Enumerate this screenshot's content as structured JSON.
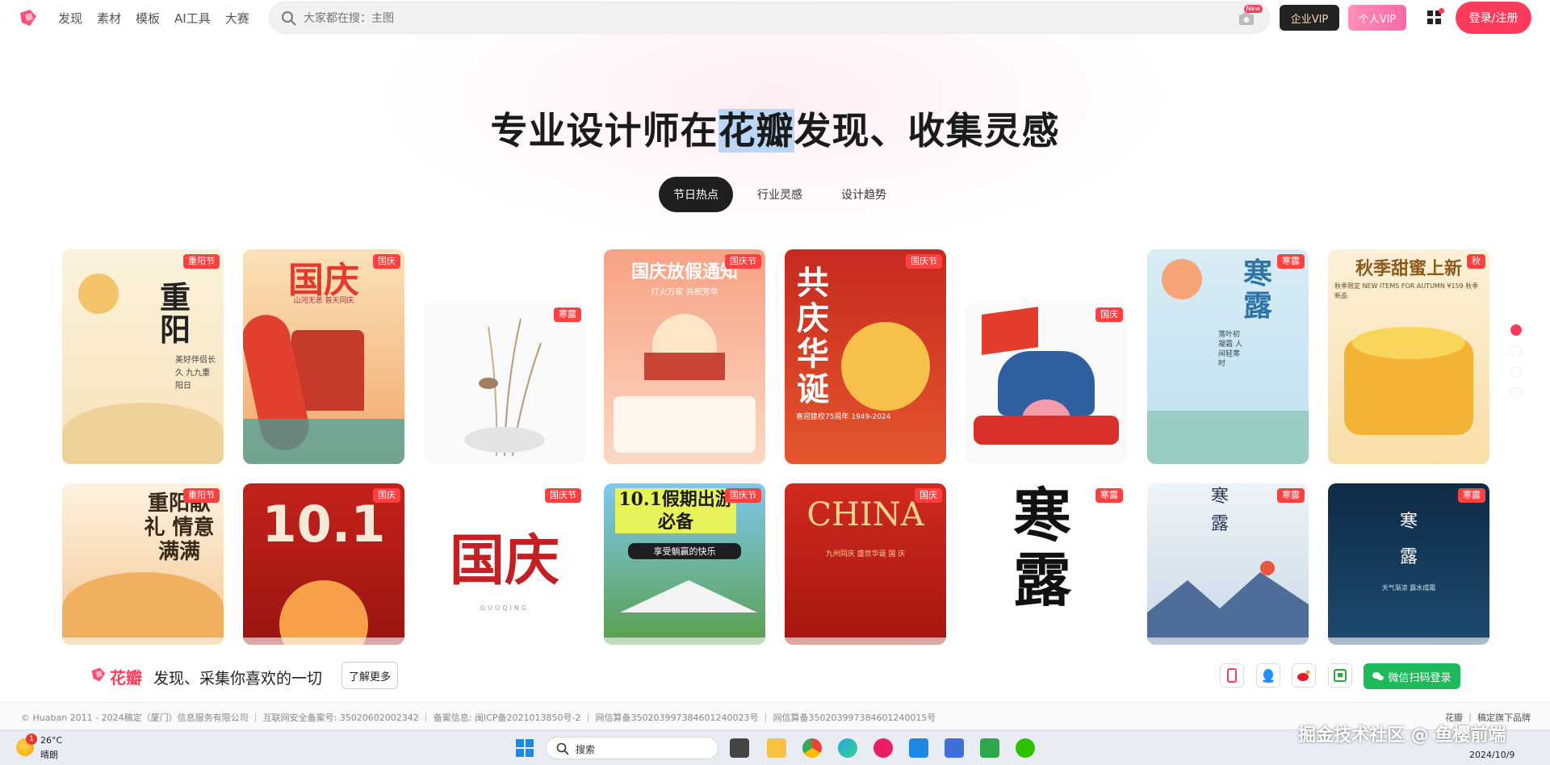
{
  "header": {
    "nav": [
      "发现",
      "素材",
      "模板",
      "AI工具",
      "大赛"
    ],
    "search_placeholder": "大家都在搜：主图",
    "new_badge": "New",
    "enterprise_vip": "企业VIP",
    "personal_vip": "个人VIP",
    "login": "登录/注册"
  },
  "hero": {
    "title_before": "专业设计师在",
    "title_highlight": "花瓣",
    "title_after": "发现、收集灵感",
    "tabs": [
      "节日热点",
      "行业灵感",
      "设计趋势"
    ]
  },
  "cards_row1": [
    {
      "tag": "重阳节",
      "art": "重阳",
      "sub": "美好伴侣长久 九九重阳日"
    },
    {
      "tag": "国庆",
      "art": "国庆",
      "sub": "山河无恙 普天同庆"
    },
    {
      "tag": "寒露",
      "art": "",
      "sub": ""
    },
    {
      "tag": "国庆节",
      "art": "国庆放假通知",
      "sub": "灯火万家 共祝芳华"
    },
    {
      "tag": "国庆节",
      "art": "共庆华诞",
      "sub": "喜迎建校75周年 1949-2024"
    },
    {
      "tag": "国庆",
      "art": "",
      "sub": ""
    },
    {
      "tag": "寒露",
      "art": "寒露",
      "sub": "落叶初凝霜 人间轻寒时"
    },
    {
      "tag": "秋",
      "art": "秋季甜蜜上新",
      "sub": "秋季限定 NEW ITEMS FOR AUTUMN ¥159 秋季新品"
    }
  ],
  "cards_row2": [
    {
      "tag": "重阳节",
      "art": "重阳献礼 情意满满",
      "sub": ""
    },
    {
      "tag": "国庆",
      "art": "10.1",
      "sub": ""
    },
    {
      "tag": "国庆节",
      "art": "国庆",
      "sub": "GUOQING"
    },
    {
      "tag": "国庆节",
      "art": "10.1假期出游必备",
      "sub": "享受躺赢的快乐"
    },
    {
      "tag": "国庆",
      "art": "CHINA",
      "sub": "九州同庆 盛世华诞 国 庆"
    },
    {
      "tag": "寒露",
      "art": "寒露",
      "sub": ""
    },
    {
      "tag": "寒露",
      "art": "寒露",
      "sub": ""
    },
    {
      "tag": "寒露",
      "art": "寒露",
      "sub": "天气渐凉 露水成霜"
    }
  ],
  "banner": {
    "brand": "花瓣",
    "slogan": "发现、采集你喜欢的一切",
    "more": "了解更多",
    "wechat_login": "微信扫码登录"
  },
  "footer": {
    "left": "© Huaban 2011 - 2024稿定（厦门）信息服务有限公司 ｜ 互联网安全备案号: 35020602002342 ｜ 备案信息: 闽ICP备2021013850号-2 ｜ 网信算备350203997384601240023号 ｜ 网信算备350203997384601240015号",
    "right": "花瓣 ｜ 稿定旗下品牌"
  },
  "taskbar": {
    "weather_badge": "1",
    "temp": "26°C",
    "weather": "晴朗",
    "search": "搜索",
    "watermark": "掘金技术社区 @ 鱼樱前端",
    "date": "2024/10/9"
  }
}
